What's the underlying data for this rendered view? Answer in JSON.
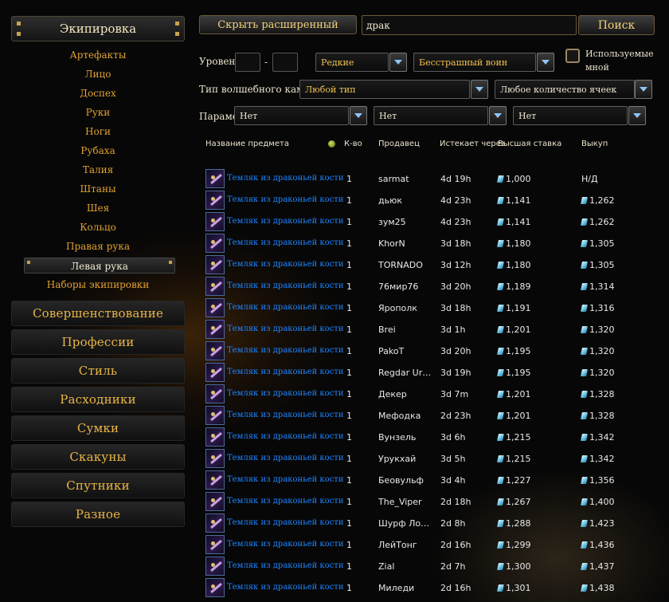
{
  "sidebar": {
    "header": "Экипировка",
    "subcategories": [
      "Артефакты",
      "Лицо",
      "Доспех",
      "Руки",
      "Ноги",
      "Рубаха",
      "Талия",
      "Штаны",
      "Шея",
      "Кольцо",
      "Правая рука",
      "Левая рука",
      "Наборы экипировки"
    ],
    "selected_subcategory": "Левая рука",
    "categories": [
      "Совершенствование",
      "Профессии",
      "Стиль",
      "Расходники",
      "Сумки",
      "Скакуны",
      "Спутники",
      "Разное"
    ]
  },
  "toolbar": {
    "hide_advanced_label": "Скрыть расширенный",
    "search_value": "драк",
    "search_button": "Поиск"
  },
  "filters": {
    "level_label": "Уровень",
    "level_from": "",
    "level_to": "",
    "level_dash": "-",
    "rarity": "Редкие",
    "class": "Бесстрашный воин",
    "usable_label_1": "Используемые",
    "usable_label_2": "мной",
    "gem_label": "Тип волшебного камня:",
    "gem_type": "Любой тип",
    "slot_count": "Любое количество ячеек",
    "param_label": "Параме",
    "param_1": "Нет",
    "param_2": "Нет",
    "param_3": "Нет"
  },
  "table": {
    "headers": {
      "name": "Название предмета",
      "qty": "К-во",
      "seller": "Продавец",
      "expires": "Истекает через",
      "bid": "Высшая ставка",
      "buyout": "Выкуп"
    },
    "rows": [
      {
        "name": "Темляк из драконьей кости",
        "qty": "1",
        "seller": "sarmat",
        "expires": "4d 19h",
        "bid": "1,000",
        "buyout": "Н/Д",
        "buyout_currency": false
      },
      {
        "name": "Темляк из драконьей кости",
        "qty": "1",
        "seller": "дьюк",
        "expires": "4d 23h",
        "bid": "1,141",
        "buyout": "1,262",
        "buyout_currency": true
      },
      {
        "name": "Темляк из драконьей кости",
        "qty": "1",
        "seller": "зум25",
        "expires": "4d 23h",
        "bid": "1,141",
        "buyout": "1,262",
        "buyout_currency": true
      },
      {
        "name": "Темляк из драконьей кости",
        "qty": "1",
        "seller": "KhorN",
        "expires": "3d 18h",
        "bid": "1,180",
        "buyout": "1,305",
        "buyout_currency": true
      },
      {
        "name": "Темляк из драконьей кости",
        "qty": "1",
        "seller": "TORNADO",
        "expires": "3d 12h",
        "bid": "1,180",
        "buyout": "1,305",
        "buyout_currency": true
      },
      {
        "name": "Темляк из драконьей кости",
        "qty": "1",
        "seller": "76мир76",
        "expires": "3d 20h",
        "bid": "1,189",
        "buyout": "1,314",
        "buyout_currency": true
      },
      {
        "name": "Темляк из драконьей кости",
        "qty": "1",
        "seller": "Ярополк",
        "expires": "3d 18h",
        "bid": "1,191",
        "buyout": "1,316",
        "buyout_currency": true
      },
      {
        "name": "Темляк из драконьей кости",
        "qty": "1",
        "seller": "Brei",
        "expires": "3d 1h",
        "bid": "1,201",
        "buyout": "1,320",
        "buyout_currency": true
      },
      {
        "name": "Темляк из драконьей кости",
        "qty": "1",
        "seller": "PakoT",
        "expires": "3d 20h",
        "bid": "1,195",
        "buyout": "1,320",
        "buyout_currency": true
      },
      {
        "name": "Темляк из драконьей кости",
        "qty": "1",
        "seller": "Regdar Urt…",
        "expires": "3d 19h",
        "bid": "1,195",
        "buyout": "1,320",
        "buyout_currency": true
      },
      {
        "name": "Темляк из драконьей кости",
        "qty": "1",
        "seller": "Декер",
        "expires": "3d 7m",
        "bid": "1,201",
        "buyout": "1,328",
        "buyout_currency": true
      },
      {
        "name": "Темляк из драконьей кости",
        "qty": "1",
        "seller": "Мефодка",
        "expires": "2d 23h",
        "bid": "1,201",
        "buyout": "1,328",
        "buyout_currency": true
      },
      {
        "name": "Темляк из драконьей кости",
        "qty": "1",
        "seller": "Вунзель",
        "expires": "3d 6h",
        "bid": "1,215",
        "buyout": "1,342",
        "buyout_currency": true
      },
      {
        "name": "Темляк из драконьей кости",
        "qty": "1",
        "seller": "Урукхай",
        "expires": "3d 5h",
        "bid": "1,215",
        "buyout": "1,342",
        "buyout_currency": true
      },
      {
        "name": "Темляк из драконьей кости",
        "qty": "1",
        "seller": "Беовульф",
        "expires": "3d 4h",
        "bid": "1,227",
        "buyout": "1,356",
        "buyout_currency": true
      },
      {
        "name": "Темляк из драконьей кости",
        "qty": "1",
        "seller": "The_Viper",
        "expires": "2d 18h",
        "bid": "1,267",
        "buyout": "1,400",
        "buyout_currency": true
      },
      {
        "name": "Темляк из драконьей кости",
        "qty": "1",
        "seller": "Шурф Лонл…",
        "expires": "2d 8h",
        "bid": "1,288",
        "buyout": "1,423",
        "buyout_currency": true
      },
      {
        "name": "Темляк из драконьей кости",
        "qty": "1",
        "seller": "ЛейТонг",
        "expires": "2d 16h",
        "bid": "1,299",
        "buyout": "1,436",
        "buyout_currency": true
      },
      {
        "name": "Темляк из драконьей кости",
        "qty": "1",
        "seller": "Zial",
        "expires": "2d 7h",
        "bid": "1,300",
        "buyout": "1,437",
        "buyout_currency": true
      },
      {
        "name": "Темляк из драконьей кости",
        "qty": "1",
        "seller": "Миледи",
        "expires": "2d 16h",
        "bid": "1,301",
        "buyout": "1,438",
        "buyout_currency": true
      }
    ]
  }
}
